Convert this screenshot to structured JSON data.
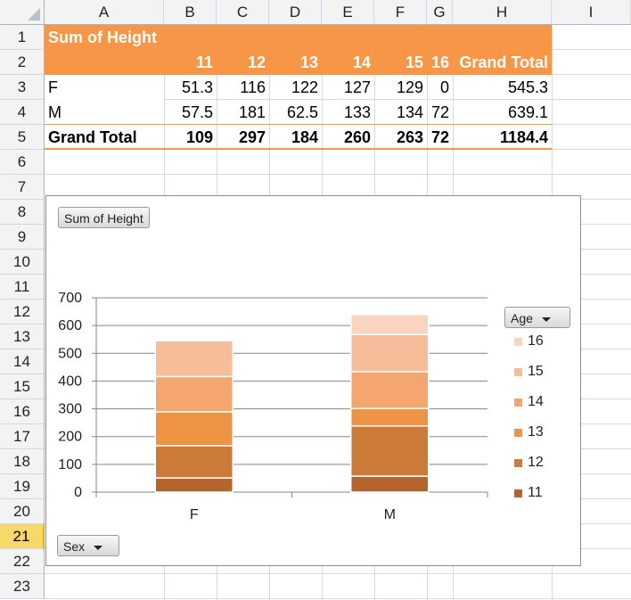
{
  "columns": [
    "A",
    "B",
    "C",
    "D",
    "E",
    "F",
    "G",
    "H",
    "I"
  ],
  "rows": [
    "1",
    "2",
    "3",
    "4",
    "5",
    "6",
    "7",
    "8",
    "9",
    "10",
    "11",
    "12",
    "13",
    "14",
    "15",
    "16",
    "17",
    "18",
    "19",
    "20",
    "21",
    "22",
    "23"
  ],
  "active_row": "21",
  "pivot": {
    "title": "Sum of Height",
    "col_labels": [
      "11",
      "12",
      "13",
      "14",
      "15",
      "16",
      "Grand Total"
    ],
    "data_rows": [
      {
        "label": "F",
        "values": [
          "51.3",
          "116",
          "122",
          "127",
          "129",
          "0",
          "545.3"
        ]
      },
      {
        "label": "M",
        "values": [
          "57.5",
          "181",
          "62.5",
          "133",
          "134",
          "72",
          "639.1"
        ]
      }
    ],
    "total_row": {
      "label": "Grand Total",
      "values": [
        "109",
        "297",
        "184",
        "260",
        "263",
        "72",
        "1184.4"
      ]
    }
  },
  "chart_ui": {
    "value_button": "Sum of Height",
    "legend_button": "Age",
    "axis_button": "Sex"
  },
  "colors": {
    "header_orange": "#f79646",
    "grid": "#d9d9d9"
  },
  "chart_data": {
    "type": "bar",
    "stacked": true,
    "categories": [
      "F",
      "M"
    ],
    "series": [
      {
        "name": "11",
        "values": [
          51.3,
          57.5
        ],
        "color": "#b4642c"
      },
      {
        "name": "12",
        "values": [
          116,
          181
        ],
        "color": "#cc7a38"
      },
      {
        "name": "13",
        "values": [
          122,
          62.5
        ],
        "color": "#ee9243"
      },
      {
        "name": "14",
        "values": [
          127,
          133
        ],
        "color": "#f5a66e"
      },
      {
        "name": "15",
        "values": [
          129,
          134
        ],
        "color": "#f7bd9b"
      },
      {
        "name": "16",
        "values": [
          0,
          72
        ],
        "color": "#f9d5c1"
      }
    ],
    "yticks": [
      "0",
      "100",
      "200",
      "300",
      "400",
      "500",
      "600",
      "700"
    ],
    "ylim": [
      0,
      700
    ],
    "legend_title": "Age",
    "legend_position": "right",
    "grid": true
  }
}
